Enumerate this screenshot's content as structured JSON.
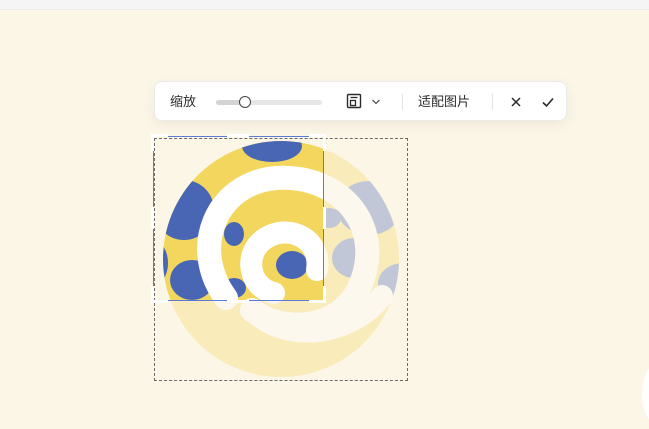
{
  "toolbar": {
    "zoom_label": "缩放",
    "zoom_level": 0.27,
    "ratio_icon": "aspect-ratio-icon",
    "dropdown_icon": "chevron-down-icon",
    "fit_label": "适配图片",
    "cancel_icon": "close-icon",
    "confirm_icon": "check-icon"
  },
  "image": {
    "description_colors": {
      "yellow": "#f3d65e",
      "blue": "#4966b4",
      "white": "#ffffff"
    }
  },
  "colors": {
    "accent": "#5b7bd5",
    "background": "#fcf6e7"
  }
}
